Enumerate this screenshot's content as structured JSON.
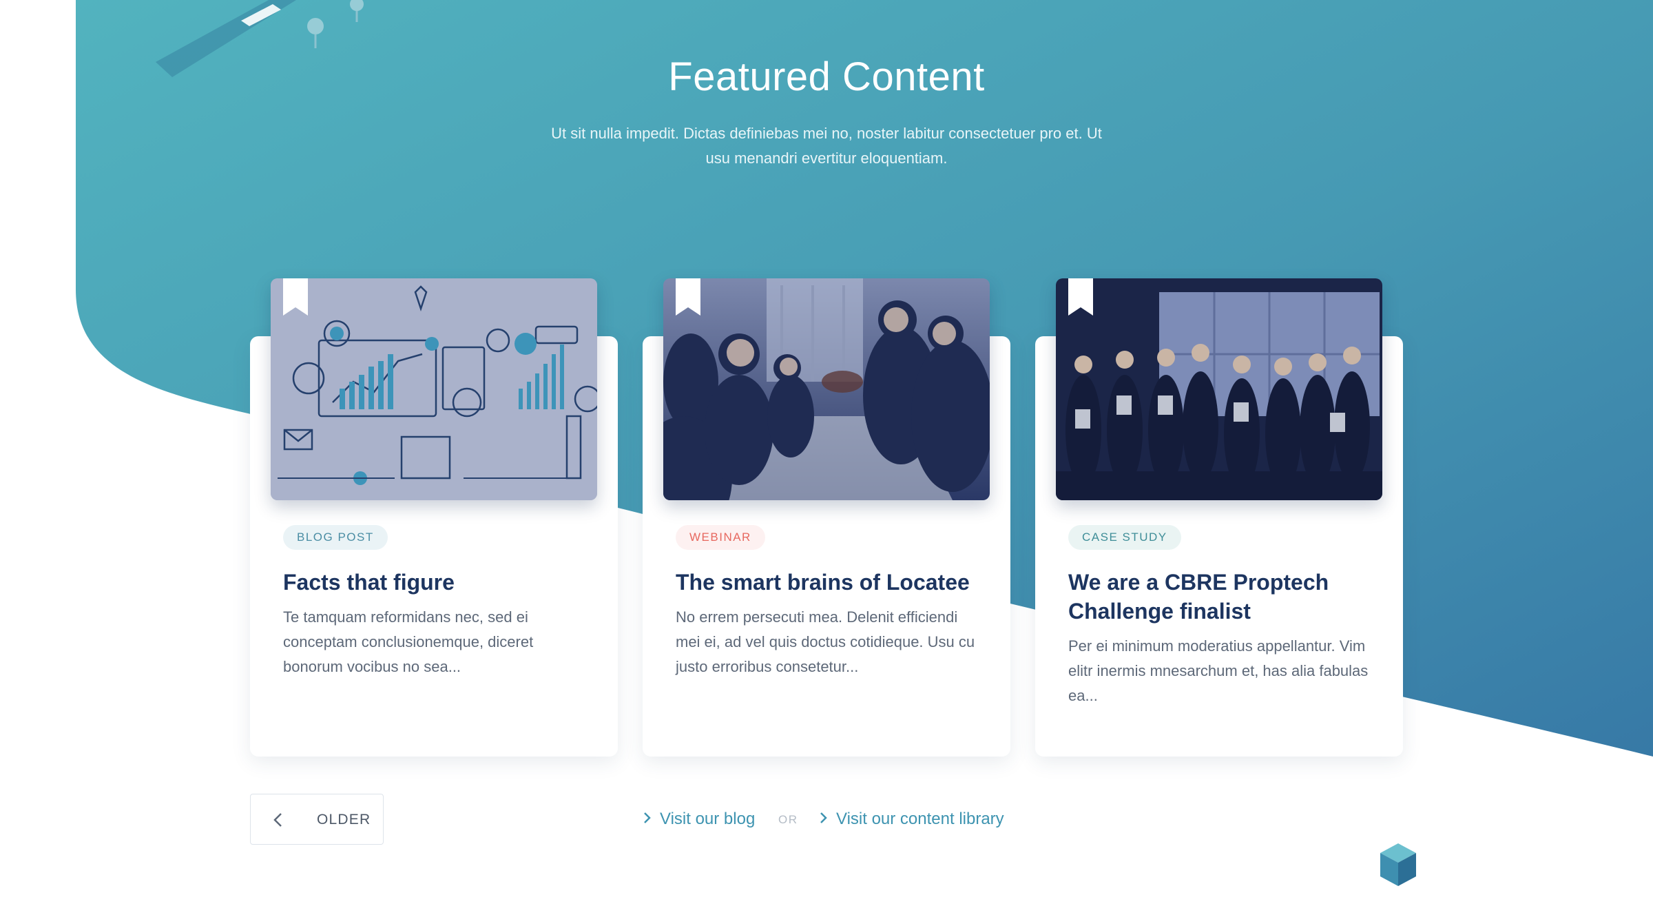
{
  "colors": {
    "teal_top": "#4fb0be",
    "teal_bottom": "#3c86ad",
    "title_navy": "#1d3560",
    "link_blue": "#3d93b0"
  },
  "hero": {
    "title": "Featured Content",
    "subtitle": "Ut sit nulla impedit. Dictas definiebas mei no, noster labitur consectetuer pro et. Ut usu menandri evertitur eloquentiam."
  },
  "cards": [
    {
      "tag": "BLOG POST",
      "title": "Facts that figure",
      "excerpt": "Te tamquam reformidans nec, sed ei conceptam conclusionemque, diceret bonorum vocibus no sea...",
      "image": "business-icons-illustration"
    },
    {
      "tag": "WEBINAR",
      "title": "The smart brains of Locatee",
      "excerpt": "No errem persecuti mea. Delenit efficiendi mei ei, ad vel quis doctus cotidieque. Usu cu justo erroribus consetetur...",
      "image": "team-meeting-photo"
    },
    {
      "tag": "CASE STUDY",
      "title": "We are a CBRE Proptech Challenge finalist",
      "excerpt": "Per ei minimum moderatius appellantur. Vim elitr inermis mnesarchum et, has alia fabulas ea...",
      "image": "award-group-photo"
    }
  ],
  "footer_nav": {
    "older_label": "OLDER",
    "blog_link": "Visit our blog",
    "or_label": "OR",
    "library_link": "Visit our content library"
  }
}
